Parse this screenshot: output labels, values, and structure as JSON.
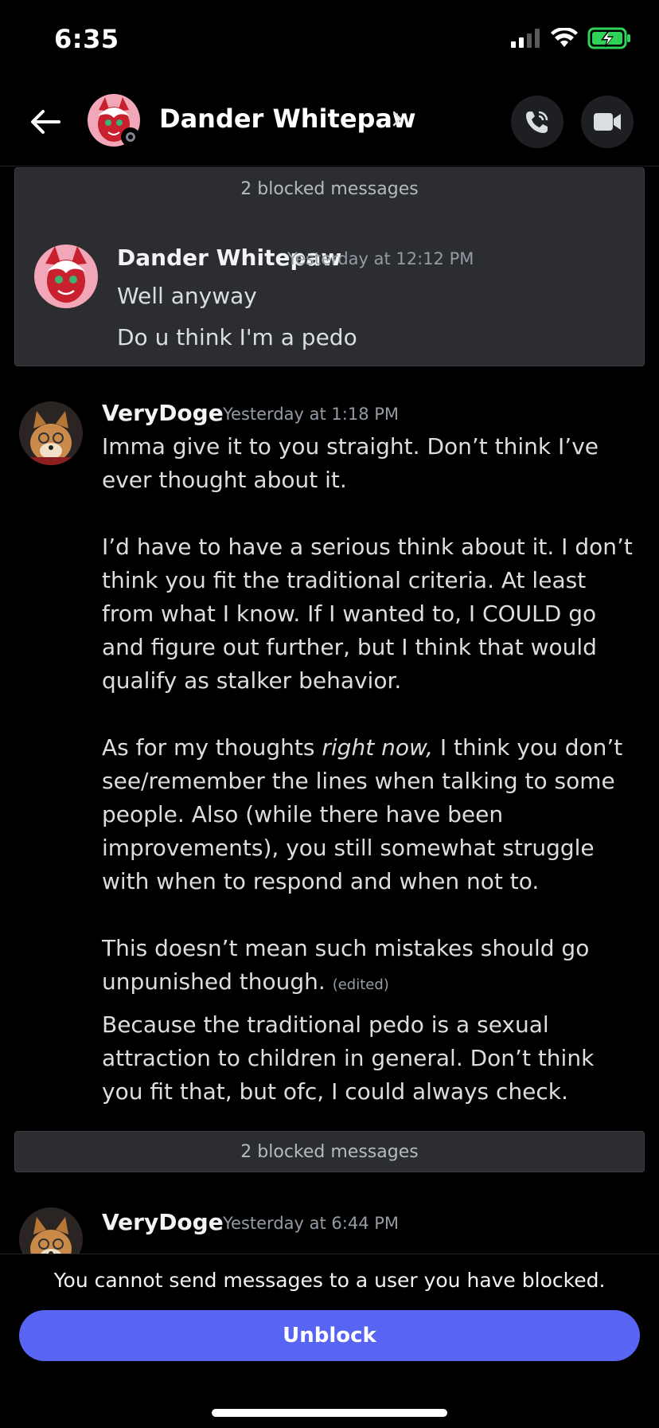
{
  "status_bar": {
    "time": "6:35"
  },
  "header": {
    "username": "Dander Whitepaw"
  },
  "blocked_group_1": {
    "label": "2 blocked messages",
    "message": {
      "author": "Dander Whitepaw",
      "timestamp": "Yesterday at 12:12 PM",
      "lines": [
        "Well anyway",
        "Do u think I'm a pedo"
      ]
    }
  },
  "message_1": {
    "author": "VeryDoge",
    "timestamp": "Yesterday at 1:18 PM",
    "para1": "Imma give it to you straight. Don’t think I’ve ever thought about it.",
    "para2": "I’d have to have a serious think about it. I don’t think you fit the traditional criteria. At least from what I know. If I wanted to, I COULD go and figure out further, but I think that would qualify as stalker behavior.",
    "para3_before": "As for my thoughts ",
    "para3_italic": "right now,",
    "para3_after": " I think you don’t see/remember the lines when talking to some people. Also (while there have been improvements), you still somewhat struggle with when to respond and when not to.",
    "para4": "This doesn’t mean such mistakes should go unpunished though.",
    "edited_label": "(edited)",
    "followup": "Because the traditional pedo is a sexual attraction to children in general. Don’t think you fit that, but ofc, I could always check."
  },
  "blocked_group_2": {
    "label": "2 blocked messages"
  },
  "message_2": {
    "author": "VeryDoge",
    "timestamp": "Yesterday at 6:44 PM"
  },
  "bottom": {
    "notice": "You cannot send messages to a user you have blocked.",
    "unblock_label": "Unblock"
  },
  "colors": {
    "background": "#000000",
    "blurple": "#5865f2",
    "blocked_bg": "#2b2d31",
    "timestamp": "#949ba4"
  },
  "icons": [
    "back-arrow-icon",
    "chevron-right-icon",
    "phone-call-icon",
    "video-camera-icon",
    "signal-icon",
    "wifi-icon",
    "battery-charging-icon"
  ]
}
